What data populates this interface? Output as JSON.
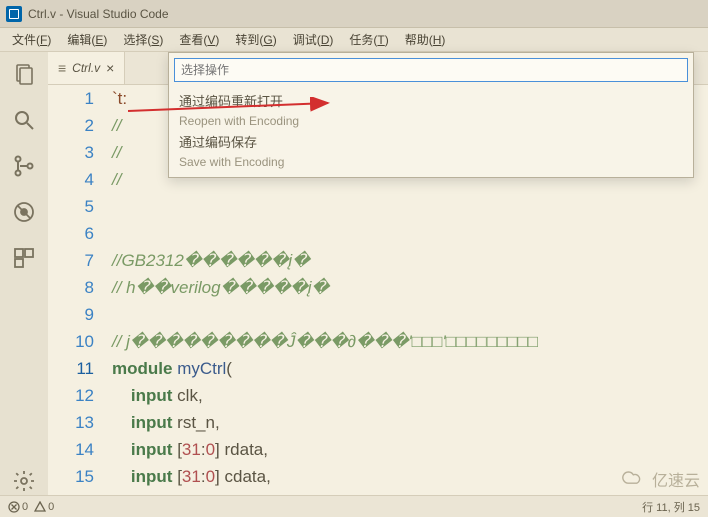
{
  "title": "Ctrl.v - Visual Studio Code",
  "menu": [
    {
      "label": "文件",
      "key": "F"
    },
    {
      "label": "编辑",
      "key": "E"
    },
    {
      "label": "选择",
      "key": "S"
    },
    {
      "label": "查看",
      "key": "V"
    },
    {
      "label": "转到",
      "key": "G"
    },
    {
      "label": "调试",
      "key": "D"
    },
    {
      "label": "任务",
      "key": "T"
    },
    {
      "label": "帮助",
      "key": "H"
    }
  ],
  "tab": {
    "name": "Ctrl.v",
    "close": "×"
  },
  "palette": {
    "placeholder": "选择操作",
    "items": [
      {
        "main": "通过编码重新打开",
        "sub": "Reopen with Encoding"
      },
      {
        "main": "通过编码保存",
        "sub": "Save with Encoding"
      }
    ]
  },
  "code": {
    "lines": [
      {
        "n": 1,
        "html": "<span class='str'>`t:</span>"
      },
      {
        "n": 2,
        "html": "<span class='comment'>//</span>"
      },
      {
        "n": 3,
        "html": "<span class='comment'>//</span>"
      },
      {
        "n": 4,
        "html": "<span class='comment'>//</span>"
      },
      {
        "n": 5,
        "html": ""
      },
      {
        "n": 6,
        "html": ""
      },
      {
        "n": 7,
        "html": "<span class='comment'>//GB2312������į�</span>"
      },
      {
        "n": 8,
        "html": "<span class='comment'>// h��verilog�����į�</span>"
      },
      {
        "n": 9,
        "html": ""
      },
      {
        "n": 10,
        "html": "<span class='comment'>// j���������Ĵ���∂���'□□□'□□□□□□□□□</span>"
      },
      {
        "n": 11,
        "html": "<span class='keyword'>module</span> <span class='ident'>myCtrl</span><span class='punct'>(</span>",
        "current": true
      },
      {
        "n": 12,
        "html": "    <span class='keyword'>input</span> clk<span class='punct'>,</span>"
      },
      {
        "n": 13,
        "html": "    <span class='keyword'>input</span> rst_n<span class='punct'>,</span>"
      },
      {
        "n": 14,
        "html": "    <span class='keyword'>input</span> <span class='punct'>[</span><span class='num'>31</span><span class='punct'>:</span><span class='num'>0</span><span class='punct'>]</span> rdata<span class='punct'>,</span>"
      },
      {
        "n": 15,
        "html": "    <span class='keyword'>input</span> <span class='punct'>[</span><span class='num'>31</span><span class='punct'>:</span><span class='num'>0</span><span class='punct'>]</span> cdata<span class='punct'>,</span>"
      }
    ]
  },
  "status": {
    "errors": "0",
    "warnings": "0",
    "cursor": "行 11, 列 15"
  },
  "watermark": "亿速云"
}
